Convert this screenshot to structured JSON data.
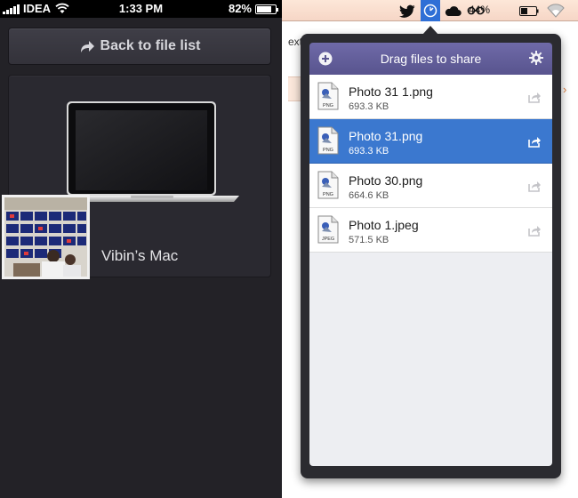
{
  "phone": {
    "status": {
      "carrier": "IDEA",
      "time": "1:33 PM",
      "battery_pct": "82%",
      "battery_level": 0.82
    },
    "back_button_label": "Back to file list",
    "device": {
      "name": "Vibin’s Mac"
    }
  },
  "mac": {
    "menubar": {
      "battery_pct": "44%",
      "battery_level": 0.44,
      "icons": [
        "twitter-icon",
        "share-app-icon",
        "cloud-icon",
        "glasses-icon",
        "battery-icon",
        "wifi-icon"
      ]
    },
    "background": {
      "fragment_text": "ext"
    },
    "popover": {
      "title": "Drag files to share",
      "files": [
        {
          "name": "Photo 31 1.png",
          "size": "693.3 KB",
          "type": "PNG",
          "selected": false
        },
        {
          "name": "Photo 31.png",
          "size": "693.3 KB",
          "type": "PNG",
          "selected": true
        },
        {
          "name": "Photo 30.png",
          "size": "664.6 KB",
          "type": "PNG",
          "selected": false
        },
        {
          "name": "Photo 1.jpeg",
          "size": "571.5 KB",
          "type": "JPEG",
          "selected": false
        }
      ]
    }
  },
  "colors": {
    "phone_bg": "#232227",
    "selected_row": "#3b78cf",
    "header_purple": "#6f6aa8",
    "menubar": "#fde7d8"
  }
}
